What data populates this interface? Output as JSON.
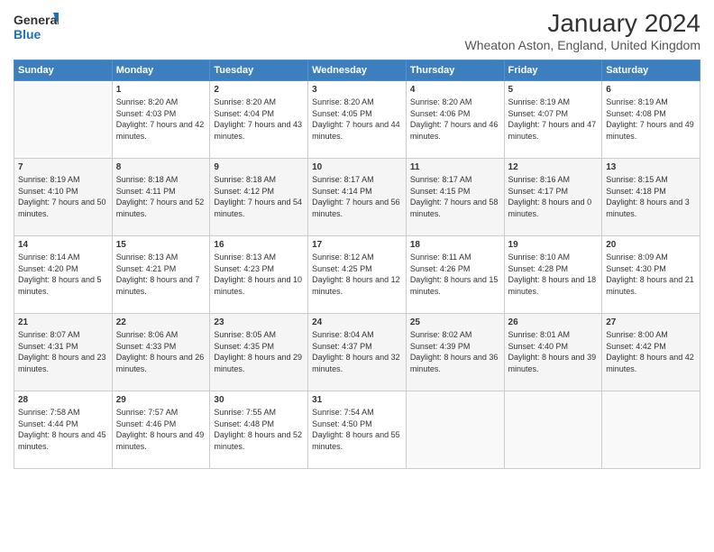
{
  "logo": {
    "line1": "General",
    "line2": "Blue"
  },
  "title": "January 2024",
  "location": "Wheaton Aston, England, United Kingdom",
  "weekdays": [
    "Sunday",
    "Monday",
    "Tuesday",
    "Wednesday",
    "Thursday",
    "Friday",
    "Saturday"
  ],
  "weeks": [
    [
      {
        "day": "",
        "sunrise": "",
        "sunset": "",
        "daylight": ""
      },
      {
        "day": "1",
        "sunrise": "Sunrise: 8:20 AM",
        "sunset": "Sunset: 4:03 PM",
        "daylight": "Daylight: 7 hours and 42 minutes."
      },
      {
        "day": "2",
        "sunrise": "Sunrise: 8:20 AM",
        "sunset": "Sunset: 4:04 PM",
        "daylight": "Daylight: 7 hours and 43 minutes."
      },
      {
        "day": "3",
        "sunrise": "Sunrise: 8:20 AM",
        "sunset": "Sunset: 4:05 PM",
        "daylight": "Daylight: 7 hours and 44 minutes."
      },
      {
        "day": "4",
        "sunrise": "Sunrise: 8:20 AM",
        "sunset": "Sunset: 4:06 PM",
        "daylight": "Daylight: 7 hours and 46 minutes."
      },
      {
        "day": "5",
        "sunrise": "Sunrise: 8:19 AM",
        "sunset": "Sunset: 4:07 PM",
        "daylight": "Daylight: 7 hours and 47 minutes."
      },
      {
        "day": "6",
        "sunrise": "Sunrise: 8:19 AM",
        "sunset": "Sunset: 4:08 PM",
        "daylight": "Daylight: 7 hours and 49 minutes."
      }
    ],
    [
      {
        "day": "7",
        "sunrise": "Sunrise: 8:19 AM",
        "sunset": "Sunset: 4:10 PM",
        "daylight": "Daylight: 7 hours and 50 minutes."
      },
      {
        "day": "8",
        "sunrise": "Sunrise: 8:18 AM",
        "sunset": "Sunset: 4:11 PM",
        "daylight": "Daylight: 7 hours and 52 minutes."
      },
      {
        "day": "9",
        "sunrise": "Sunrise: 8:18 AM",
        "sunset": "Sunset: 4:12 PM",
        "daylight": "Daylight: 7 hours and 54 minutes."
      },
      {
        "day": "10",
        "sunrise": "Sunrise: 8:17 AM",
        "sunset": "Sunset: 4:14 PM",
        "daylight": "Daylight: 7 hours and 56 minutes."
      },
      {
        "day": "11",
        "sunrise": "Sunrise: 8:17 AM",
        "sunset": "Sunset: 4:15 PM",
        "daylight": "Daylight: 7 hours and 58 minutes."
      },
      {
        "day": "12",
        "sunrise": "Sunrise: 8:16 AM",
        "sunset": "Sunset: 4:17 PM",
        "daylight": "Daylight: 8 hours and 0 minutes."
      },
      {
        "day": "13",
        "sunrise": "Sunrise: 8:15 AM",
        "sunset": "Sunset: 4:18 PM",
        "daylight": "Daylight: 8 hours and 3 minutes."
      }
    ],
    [
      {
        "day": "14",
        "sunrise": "Sunrise: 8:14 AM",
        "sunset": "Sunset: 4:20 PM",
        "daylight": "Daylight: 8 hours and 5 minutes."
      },
      {
        "day": "15",
        "sunrise": "Sunrise: 8:13 AM",
        "sunset": "Sunset: 4:21 PM",
        "daylight": "Daylight: 8 hours and 7 minutes."
      },
      {
        "day": "16",
        "sunrise": "Sunrise: 8:13 AM",
        "sunset": "Sunset: 4:23 PM",
        "daylight": "Daylight: 8 hours and 10 minutes."
      },
      {
        "day": "17",
        "sunrise": "Sunrise: 8:12 AM",
        "sunset": "Sunset: 4:25 PM",
        "daylight": "Daylight: 8 hours and 12 minutes."
      },
      {
        "day": "18",
        "sunrise": "Sunrise: 8:11 AM",
        "sunset": "Sunset: 4:26 PM",
        "daylight": "Daylight: 8 hours and 15 minutes."
      },
      {
        "day": "19",
        "sunrise": "Sunrise: 8:10 AM",
        "sunset": "Sunset: 4:28 PM",
        "daylight": "Daylight: 8 hours and 18 minutes."
      },
      {
        "day": "20",
        "sunrise": "Sunrise: 8:09 AM",
        "sunset": "Sunset: 4:30 PM",
        "daylight": "Daylight: 8 hours and 21 minutes."
      }
    ],
    [
      {
        "day": "21",
        "sunrise": "Sunrise: 8:07 AM",
        "sunset": "Sunset: 4:31 PM",
        "daylight": "Daylight: 8 hours and 23 minutes."
      },
      {
        "day": "22",
        "sunrise": "Sunrise: 8:06 AM",
        "sunset": "Sunset: 4:33 PM",
        "daylight": "Daylight: 8 hours and 26 minutes."
      },
      {
        "day": "23",
        "sunrise": "Sunrise: 8:05 AM",
        "sunset": "Sunset: 4:35 PM",
        "daylight": "Daylight: 8 hours and 29 minutes."
      },
      {
        "day": "24",
        "sunrise": "Sunrise: 8:04 AM",
        "sunset": "Sunset: 4:37 PM",
        "daylight": "Daylight: 8 hours and 32 minutes."
      },
      {
        "day": "25",
        "sunrise": "Sunrise: 8:02 AM",
        "sunset": "Sunset: 4:39 PM",
        "daylight": "Daylight: 8 hours and 36 minutes."
      },
      {
        "day": "26",
        "sunrise": "Sunrise: 8:01 AM",
        "sunset": "Sunset: 4:40 PM",
        "daylight": "Daylight: 8 hours and 39 minutes."
      },
      {
        "day": "27",
        "sunrise": "Sunrise: 8:00 AM",
        "sunset": "Sunset: 4:42 PM",
        "daylight": "Daylight: 8 hours and 42 minutes."
      }
    ],
    [
      {
        "day": "28",
        "sunrise": "Sunrise: 7:58 AM",
        "sunset": "Sunset: 4:44 PM",
        "daylight": "Daylight: 8 hours and 45 minutes."
      },
      {
        "day": "29",
        "sunrise": "Sunrise: 7:57 AM",
        "sunset": "Sunset: 4:46 PM",
        "daylight": "Daylight: 8 hours and 49 minutes."
      },
      {
        "day": "30",
        "sunrise": "Sunrise: 7:55 AM",
        "sunset": "Sunset: 4:48 PM",
        "daylight": "Daylight: 8 hours and 52 minutes."
      },
      {
        "day": "31",
        "sunrise": "Sunrise: 7:54 AM",
        "sunset": "Sunset: 4:50 PM",
        "daylight": "Daylight: 8 hours and 55 minutes."
      },
      {
        "day": "",
        "sunrise": "",
        "sunset": "",
        "daylight": ""
      },
      {
        "day": "",
        "sunrise": "",
        "sunset": "",
        "daylight": ""
      },
      {
        "day": "",
        "sunrise": "",
        "sunset": "",
        "daylight": ""
      }
    ]
  ]
}
